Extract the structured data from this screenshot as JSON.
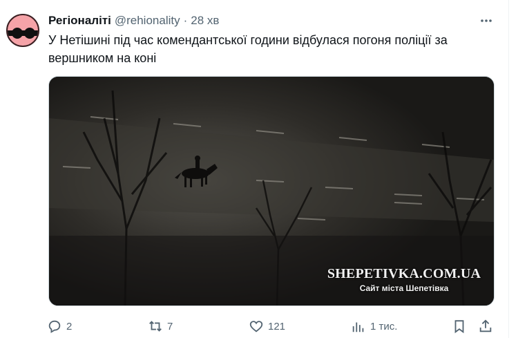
{
  "tweet": {
    "author_name": "Регіоналіті",
    "author_handle": "@rehionality",
    "separator": "·",
    "time": "28 хв",
    "text": "У Нетішині під час комендантської години відбулася погоня поліції за вершником на коні"
  },
  "media": {
    "watermark_site": "SHEPETIVKA.COM.UA",
    "watermark_caption": "Сайт міста Шепетівка"
  },
  "actions": {
    "replies": "2",
    "retweets": "7",
    "likes": "121",
    "views": "1 тис."
  },
  "icons": {
    "more": "more-icon",
    "reply": "reply-icon",
    "retweet": "retweet-icon",
    "like": "heart-icon",
    "views": "views-icon",
    "bookmark": "bookmark-icon",
    "share": "share-icon"
  }
}
